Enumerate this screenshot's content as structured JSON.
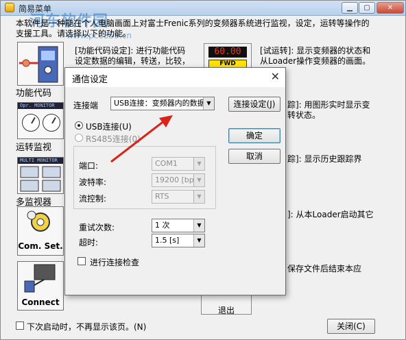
{
  "window": {
    "title": "简易菜单",
    "watermark": "河东软件园",
    "watermark_url": "www.pc0359.cn"
  },
  "intro": {
    "text": "本软件是一种能在个人电脑画面上对富士Frenic系列的变频器系统进行监视，设定，运转等操作的支援工具。请选择以下的功能。"
  },
  "sidebar": {
    "items": [
      {
        "label": "功能代码"
      },
      {
        "label": "运转监视"
      },
      {
        "label": "多监视器"
      },
      {
        "label": "Com. Set."
      },
      {
        "label": "Connect"
      }
    ]
  },
  "panels": {
    "func_code": "[功能代码设定]: 进行功能代码设定数据的编辑，转送，比较，初始化等操作。",
    "test_run": "[试运转]: 显示变频器的状态和从Loader操作变频器的画面。",
    "trace": "踪]: 用图形实时显示变转状态。",
    "history": "踪]: 显示历史跟踪界",
    "launch": "]: 从本Loader启动其它",
    "save": "保存文件后结束本应",
    "exit_label": "退出",
    "fwd_label": "FWD",
    "digits": "60.00"
  },
  "monitor_icons": {
    "opr": "Opr. MONITOR",
    "multi": "MULTI MONITOR"
  },
  "footer": {
    "checkbox_label": "下次启动时，不再显示该页。(N)",
    "close_button": "关闭(C)"
  },
  "dialog": {
    "title": "通信设定",
    "conn_label": "连接端",
    "conn_value": "USB连接：变频器内的数据",
    "conn_settings_button": "连接设定(J)",
    "usb_radio": "USB连接(U)",
    "rs485_radio": "RS485连接(0)",
    "ok_button": "确定",
    "cancel_button": "取消",
    "port_label": "端口:",
    "port_value": "COM1",
    "baud_label": "波特率:",
    "baud_value": "19200 [bps]",
    "flow_label": "流控制:",
    "flow_value": "RTS",
    "retry_label": "重试次数:",
    "retry_value": "1 次",
    "timeout_label": "超时:",
    "timeout_value": "1.5 [s]",
    "check_label": "进行连接检查"
  },
  "colors": {
    "arrow": "#d9241c",
    "watermark": "#2878c8"
  }
}
